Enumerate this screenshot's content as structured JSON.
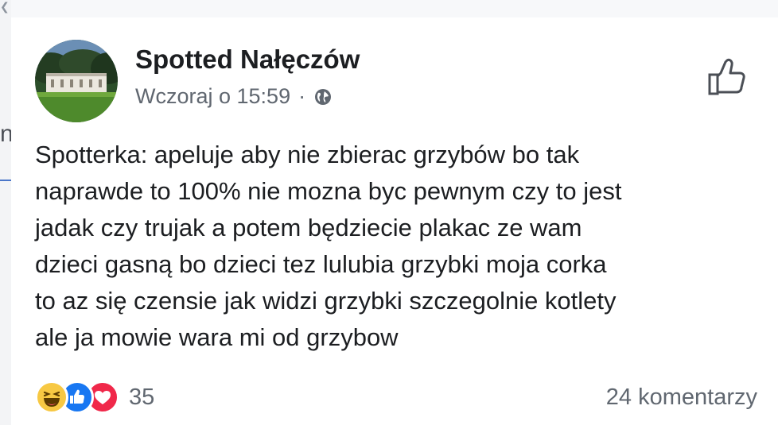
{
  "post": {
    "page_name": "Spotted Nałęczów",
    "timestamp": "Wczoraj o 15:59",
    "separator": "·",
    "privacy_icon": "globe-icon",
    "text_lines": [
      "Spotterka: apeluje aby nie zbierac grzybów bo tak",
      "naprawde to 100% nie mozna byc pewnym czy to jest",
      "jadak czy trujak a potem będziecie plakac ze wam",
      "dzieci gasną bo dzieci tez lulubia grzybki moja corka",
      "to az się czensie jak widzi grzybki szczegolnie kotlety",
      "ale ja mowie wara mi od grzybow"
    ]
  },
  "reactions": {
    "icons": [
      "haha-icon",
      "like-icon",
      "love-icon"
    ],
    "count": "35"
  },
  "comments": {
    "label": "24 komentarzy"
  },
  "sidebar": {
    "glyph": "n"
  },
  "colors": {
    "text": "#1c1e21",
    "secondary": "#606770",
    "like_blue": "#1877f2",
    "love_red": "#f0284a",
    "haha_yellow": "#f7c843"
  }
}
